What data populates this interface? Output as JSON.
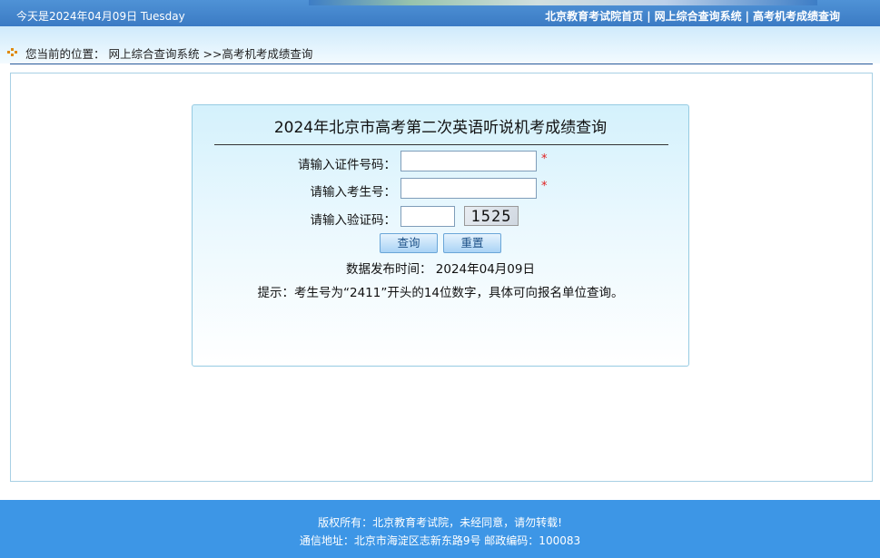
{
  "topbar": {
    "date_text": "今天是2024年04月09日 Tuesday",
    "links": [
      "北京教育考试院首页",
      "网上综合查询系统",
      "高考机考成绩查询"
    ],
    "separator": "|"
  },
  "breadcrumb": {
    "prefix": "您当前的位置：",
    "path": "网上综合查询系统 >>高考机考成绩查询"
  },
  "form": {
    "title": "2024年北京市高考第二次英语听说机考成绩查询",
    "id_label": "请输入证件号码：",
    "id_value": "",
    "exam_label": "请输入考生号：",
    "exam_value": "",
    "captcha_label": "请输入验证码：",
    "captcha_value": "",
    "captcha_image_text": "1525",
    "required_mark": "*",
    "query_button": "查询",
    "reset_button": "重置",
    "pub_time": "数据发布时间： 2024年04月09日",
    "hint": "提示：考生号为“2411”开头的14位数字，具体可向报名单位查询。"
  },
  "footer": {
    "line1": "版权所有：北京教育考试院，未经同意，请勿转载!",
    "line2": "通信地址：北京市海淀区志新东路9号 邮政编码：100083"
  },
  "colors": {
    "topbar": "#3b7bc4",
    "footer": "#3d96e6",
    "required": "#e02020"
  }
}
